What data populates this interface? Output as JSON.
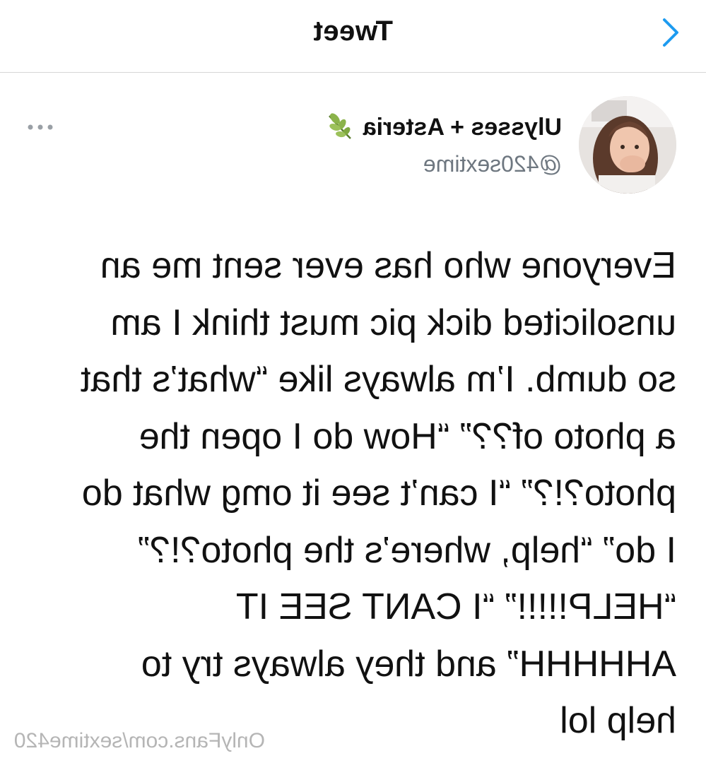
{
  "header": {
    "title": "Tweet",
    "back_icon": "chevron-left-icon",
    "accent_color": "#1d9bf0"
  },
  "tweet": {
    "author": {
      "display_name": "Ulysses + Asteria",
      "name_emoji": "herb-icon",
      "handle": "@420sextime"
    },
    "more_icon": "more-dots-icon",
    "text": "Everyone who has ever sent me an\nunsolicited dick pic must think I am\nso dumb. I’m always like “what’s that\na photo of??” “How do I open the\nphoto?!?” “I can’t see it omg what do\nI do” “help, where’s the photo?!?”\n“HELP!!!!!” “I CANT SEE IT\nAHHHHH” and they always try to\nhelp lol"
  },
  "watermark": {
    "text": "OnlyFans.com/sextime420"
  }
}
